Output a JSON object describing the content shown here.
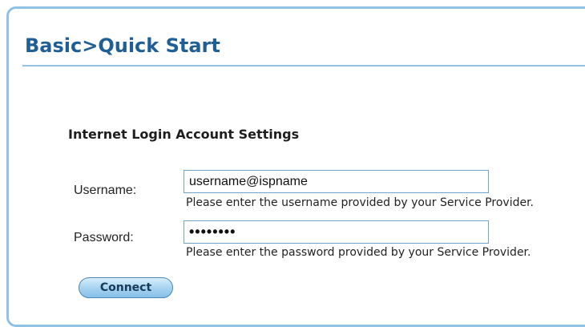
{
  "page": {
    "title": "Basic>Quick Start"
  },
  "section": {
    "title": "Internet Login Account Settings"
  },
  "username": {
    "label": "Username:",
    "value": "username@ispname",
    "help": "Please enter the username provided by your Service Provider."
  },
  "password": {
    "label": "Password:",
    "value": "••••••••",
    "help": "Please enter the password provided by your Service Provider."
  },
  "actions": {
    "connect_label": "Connect"
  },
  "colors": {
    "accent": "#1f5f96",
    "border": "#8ec3e6",
    "button": "#a8d4f1"
  }
}
